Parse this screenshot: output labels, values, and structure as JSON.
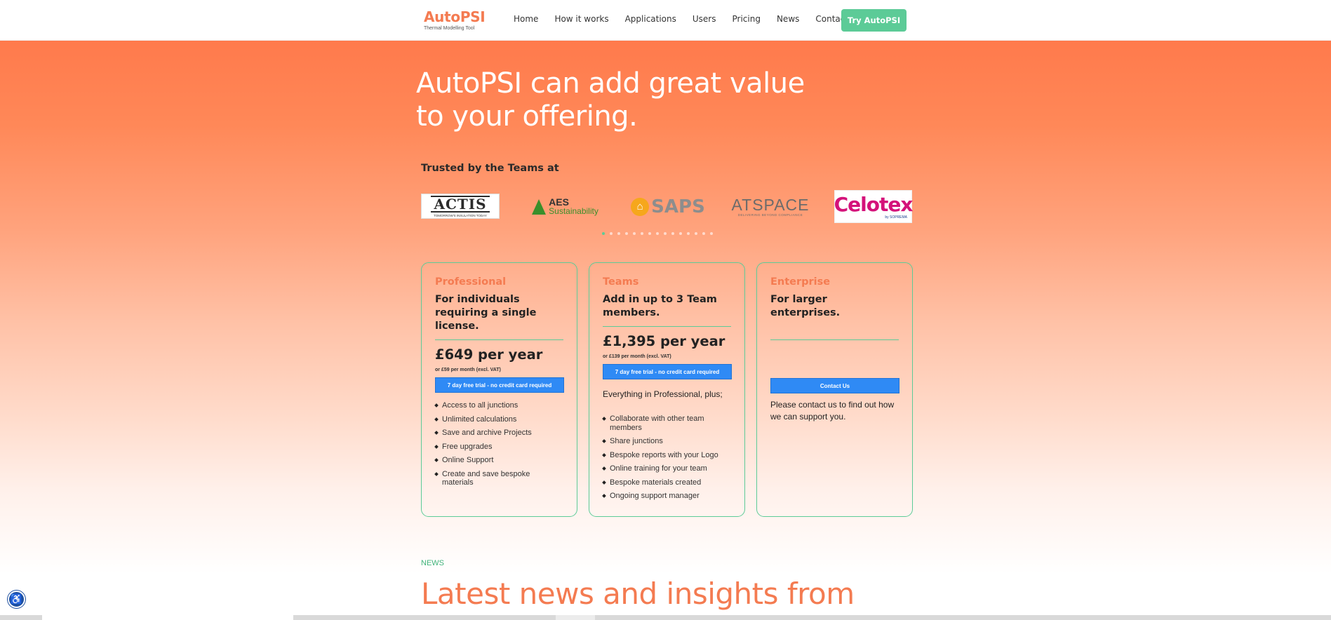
{
  "header": {
    "logo_name": "AutoPSI",
    "logo_tagline": "Thermal Modelling Tool",
    "nav": [
      "Home",
      "How it works",
      "Applications",
      "Users",
      "Pricing",
      "News",
      "Contact"
    ],
    "cta": "Try AutoPSI"
  },
  "hero": {
    "title": "AutoPSI can add great value to your offering.",
    "trusted_label": "Trusted by the Teams at"
  },
  "partner_logos": [
    {
      "icon": "actis-logo",
      "text": "ACTIS",
      "sub": "TOMORROW'S INSULATION TODAY"
    },
    {
      "icon": "aes-logo",
      "text": "AES",
      "sub": "Sustainability"
    },
    {
      "icon": "saps-logo",
      "text": "SAPS"
    },
    {
      "icon": "atspace-logo",
      "text": "ATSPACE",
      "sub": "DELIVERING BEYOND COMPLIANCE"
    },
    {
      "icon": "celotex-logo",
      "text": "Celotex",
      "sub": "by SOPREMA"
    }
  ],
  "carousel": {
    "total": 15,
    "active": 0
  },
  "plans": [
    {
      "name": "Professional",
      "description": "For individuals requiring a single license.",
      "price": "£649 per year",
      "monthly": "or £59 per month (excl. VAT)",
      "cta": "7 day free trial - no credit card required",
      "features": [
        "Access to all junctions",
        "Unlimited calculations",
        "Save and archive Projects",
        "Free upgrades",
        "Online Support",
        "Create and save bespoke materials"
      ]
    },
    {
      "name": "Teams",
      "description": "Add in up to 3 Team members.",
      "price": "£1,395 per year",
      "monthly": "or £139 per month (excl. VAT)",
      "cta": "7 day free trial - no credit card required",
      "intro": "Everything in Professional, plus;",
      "features": [
        "Collaborate with other team members",
        "Share junctions",
        "Bespoke reports with your Logo",
        "Online training for your team",
        "Bespoke materials created",
        "Ongoing support manager"
      ]
    },
    {
      "name": "Enterprise",
      "description": "For larger enterprises.",
      "cta": "Contact Us",
      "text": "Please contact us to find out how we can support you."
    }
  ],
  "news": {
    "eyebrow": "NEWS",
    "title": "Latest news and insights from"
  },
  "colors": {
    "accent_orange": "#f47b51",
    "accent_green": "#5ccb97",
    "button_blue": "#2f8af5"
  },
  "accessibility_icon": "accessibility-icon"
}
